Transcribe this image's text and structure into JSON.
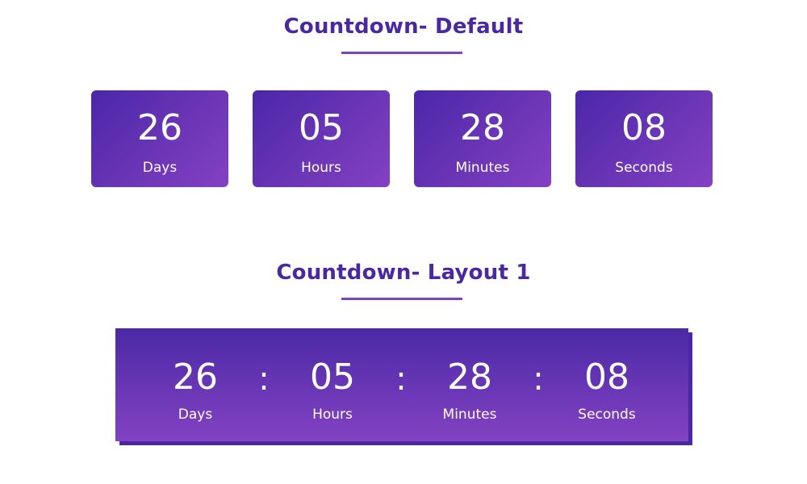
{
  "sections": {
    "default": {
      "title": "Countdown- Default",
      "units": {
        "days": {
          "value": "26",
          "label": "Days"
        },
        "hours": {
          "value": "05",
          "label": "Hours"
        },
        "minutes": {
          "value": "28",
          "label": "Minutes"
        },
        "seconds": {
          "value": "08",
          "label": "Seconds"
        }
      }
    },
    "layout1": {
      "title": "Countdown- Layout 1",
      "separator": ":",
      "units": {
        "days": {
          "value": "26",
          "label": "Days"
        },
        "hours": {
          "value": "05",
          "label": "Hours"
        },
        "minutes": {
          "value": "28",
          "label": "Minutes"
        },
        "seconds": {
          "value": "08",
          "label": "Seconds"
        }
      }
    }
  },
  "colors": {
    "title": "#4a27a3",
    "underline": "#7e43c1",
    "gradient_start": "#4a27a8",
    "gradient_end": "#8440c3",
    "text_on_card": "#ffffff"
  }
}
